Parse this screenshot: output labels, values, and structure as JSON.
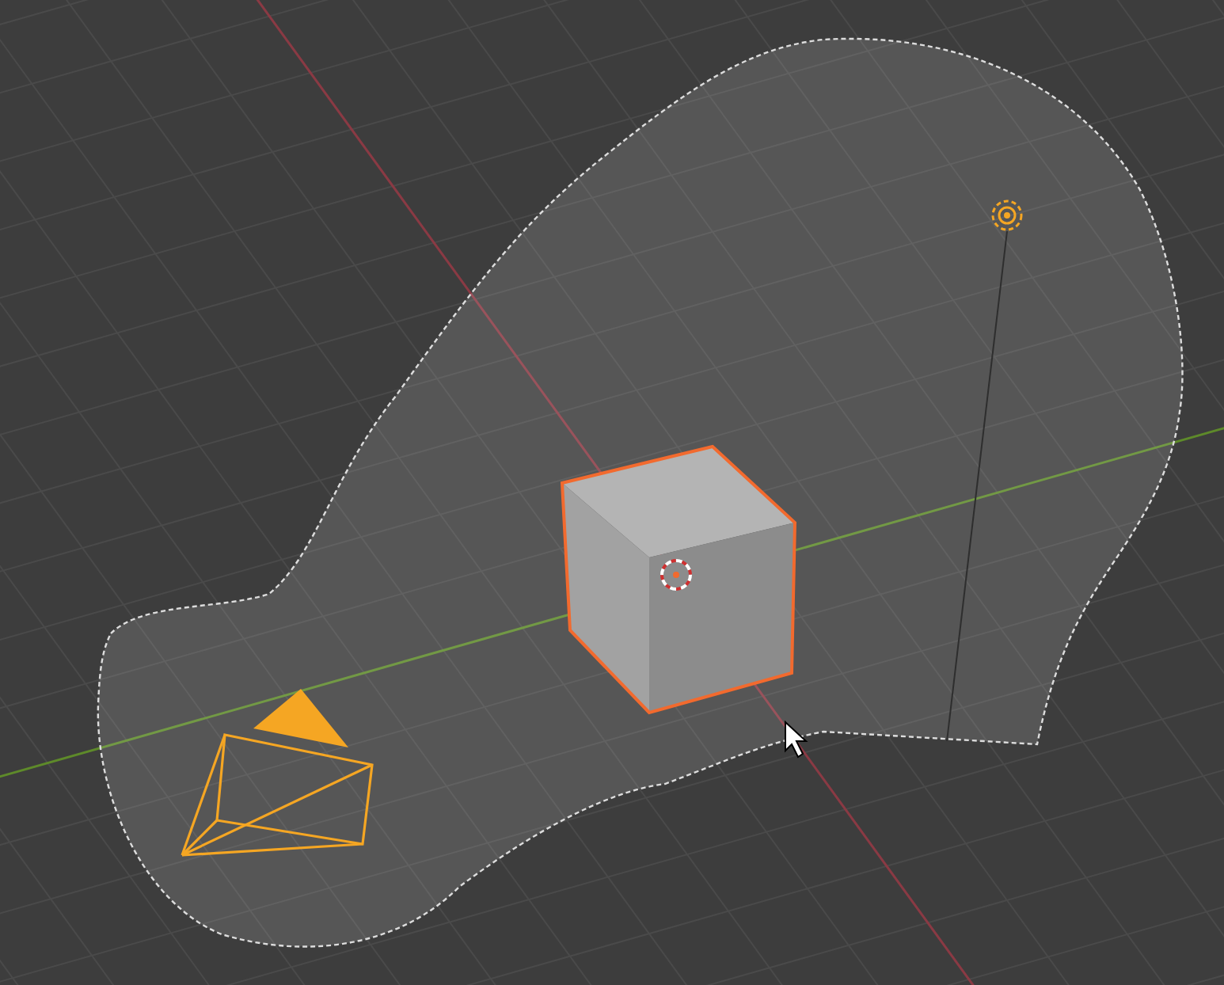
{
  "viewport": {
    "lasso_active": true,
    "objects": [
      {
        "kind": "cube",
        "selected": true,
        "active": true
      },
      {
        "kind": "camera",
        "selected": true,
        "active": false
      },
      {
        "kind": "light",
        "selected": true,
        "active": false
      }
    ]
  }
}
